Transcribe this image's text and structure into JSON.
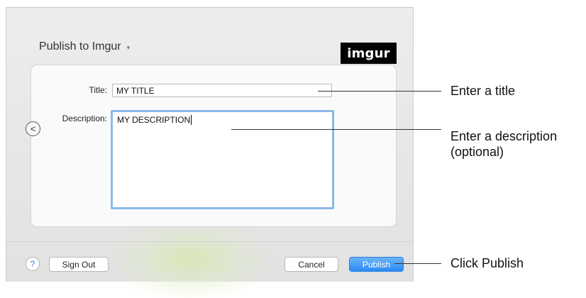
{
  "dialog": {
    "service_label": "Publish to Imgur",
    "service_chevron": "▾",
    "logo_text": "imgur",
    "back_icon": "chevron-left-icon",
    "form": {
      "title_label": "Title:",
      "title_value": "MY TITLE",
      "description_label": "Description:",
      "description_value": "MY DESCRIPTION"
    },
    "footer": {
      "help_label": "?",
      "sign_out_label": "Sign Out",
      "cancel_label": "Cancel",
      "publish_label": "Publish"
    }
  },
  "callouts": {
    "title": "Enter a title",
    "description_line1": "Enter a description",
    "description_line2": "(optional)",
    "publish": "Click Publish"
  },
  "colors": {
    "accent": "#2a8bf2",
    "focus_ring": "#8ab8e8"
  }
}
